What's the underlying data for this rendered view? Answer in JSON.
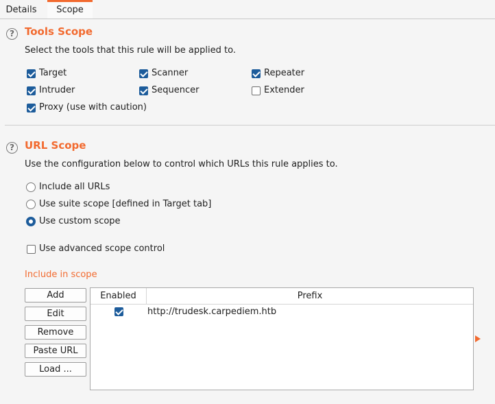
{
  "tabs": [
    {
      "label": "Details"
    },
    {
      "label": "Scope"
    }
  ],
  "tools_scope": {
    "help_glyph": "?",
    "title": "Tools Scope",
    "description": "Select the tools that this rule will be applied to.",
    "tools": [
      {
        "label": "Target",
        "checked": true
      },
      {
        "label": "Scanner",
        "checked": true
      },
      {
        "label": "Repeater",
        "checked": true
      },
      {
        "label": "Intruder",
        "checked": true
      },
      {
        "label": "Sequencer",
        "checked": true
      },
      {
        "label": "Extender",
        "checked": false
      },
      {
        "label": "Proxy (use with caution)",
        "checked": true
      }
    ]
  },
  "url_scope": {
    "help_glyph": "?",
    "title": "URL Scope",
    "description": "Use the configuration below to control which URLs this rule applies to.",
    "options": [
      {
        "label": "Include all URLs",
        "selected": false
      },
      {
        "label": "Use suite scope [defined in Target tab]",
        "selected": false
      },
      {
        "label": "Use custom scope",
        "selected": true
      }
    ],
    "advanced": {
      "label": "Use advanced scope control",
      "checked": false
    }
  },
  "include": {
    "label": "Include in scope",
    "buttons": [
      "Add",
      "Edit",
      "Remove",
      "Paste URL",
      "Load ..."
    ],
    "columns": [
      "Enabled",
      "Prefix"
    ],
    "rows": [
      {
        "enabled": true,
        "prefix": "http://trudesk.carpediem.htb"
      }
    ]
  },
  "colors": {
    "accent": "#f26a2f",
    "check": "#1d5c9b"
  }
}
